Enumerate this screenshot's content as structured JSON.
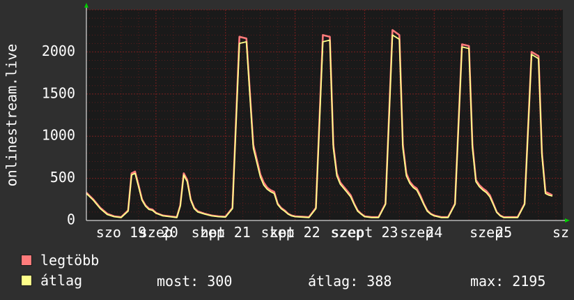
{
  "colors": {
    "background": "#2f2f2f",
    "plot_background": "#1a1a1a",
    "grid": "#7a1f1f",
    "axis": "#ffffff",
    "text": "#ffffff",
    "max_series": "#ff7b7b",
    "avg_series": "#ffff8a",
    "arrow": "#00cc00"
  },
  "legend": [
    {
      "label": "legtöbb",
      "color": "#ff7b7b"
    },
    {
      "label": "átlag",
      "color": "#ffff8a"
    }
  ],
  "stats": {
    "now": "most: 300",
    "avg": "átlag: 388",
    "max": "max: 2195"
  },
  "chart_data": {
    "type": "line",
    "title": "",
    "ylabel": "onlinestream.live",
    "xlabel": "",
    "ylim": [
      0,
      2500
    ],
    "y_ticks": [
      0,
      500,
      1000,
      1500,
      2000
    ],
    "grid": true,
    "legend_position": "bottom-left",
    "x_tick_labels": [
      {
        "label": "szo 19",
        "x": 0.5
      },
      {
        "label": "szep",
        "x": 1.0
      },
      {
        "label": "20",
        "x": 1.2
      },
      {
        "label": "szep",
        "x": 1.75
      },
      {
        "label": "hpt 21",
        "x": 2.0
      },
      {
        "label": "szep",
        "x": 2.75
      },
      {
        "label": "kpt 22",
        "x": 3.0
      },
      {
        "label": "szep",
        "x": 3.75
      },
      {
        "label": "szept 23",
        "x": 4.0
      },
      {
        "label": "szep",
        "x": 4.75
      },
      {
        "label": "24",
        "x": 5.0
      },
      {
        "label": "szep",
        "x": 5.75
      },
      {
        "label": "25",
        "x": 6.0
      },
      {
        "label": "sz",
        "x": 6.82
      }
    ],
    "x": [
      0.0,
      0.1,
      0.2,
      0.3,
      0.4,
      0.5,
      0.6,
      0.65,
      0.7,
      0.75,
      0.8,
      0.85,
      0.9,
      0.95,
      1.0,
      1.1,
      1.2,
      1.3,
      1.35,
      1.4,
      1.45,
      1.5,
      1.55,
      1.6,
      1.7,
      1.8,
      1.9,
      2.0,
      2.1,
      2.2,
      2.3,
      2.4,
      2.5,
      2.55,
      2.6,
      2.65,
      2.7,
      2.75,
      2.8,
      2.85,
      2.9,
      2.95,
      3.0,
      3.1,
      3.2,
      3.3,
      3.4,
      3.5,
      3.55,
      3.6,
      3.65,
      3.7,
      3.75,
      3.8,
      3.85,
      3.9,
      3.95,
      4.0,
      4.1,
      4.2,
      4.3,
      4.4,
      4.5,
      4.55,
      4.6,
      4.65,
      4.7,
      4.75,
      4.8,
      4.85,
      4.9,
      4.95,
      5.0,
      5.1,
      5.2,
      5.3,
      5.4,
      5.5,
      5.55,
      5.6,
      5.65,
      5.7,
      5.75,
      5.8,
      5.85,
      5.9,
      5.95,
      6.0,
      6.1,
      6.2,
      6.3,
      6.4,
      6.5,
      6.55,
      6.6,
      6.65,
      6.7,
      6.75,
      6.8,
      6.85
    ],
    "series": [
      {
        "name": "legtöbb",
        "color": "#ff7b7b",
        "values": [
          330,
          250,
          150,
          80,
          50,
          40,
          120,
          560,
          580,
          420,
          250,
          180,
          140,
          130,
          90,
          60,
          50,
          40,
          180,
          560,
          480,
          250,
          150,
          110,
          80,
          60,
          50,
          45,
          150,
          2180,
          2160,
          900,
          550,
          450,
          390,
          360,
          340,
          200,
          150,
          120,
          80,
          60,
          50,
          45,
          40,
          150,
          2200,
          2180,
          900,
          560,
          450,
          400,
          350,
          300,
          200,
          120,
          80,
          50,
          40,
          40,
          200,
          2260,
          2200,
          900,
          560,
          460,
          410,
          380,
          300,
          200,
          120,
          80,
          60,
          40,
          40,
          200,
          2090,
          2070,
          900,
          480,
          420,
          380,
          350,
          300,
          200,
          100,
          60,
          40,
          40,
          40,
          200,
          2000,
          1950,
          800,
          340,
          320,
          300
        ]
      },
      {
        "name": "átlag",
        "color": "#ffff8a",
        "values": [
          320,
          240,
          140,
          70,
          45,
          35,
          110,
          540,
          560,
          400,
          240,
          170,
          130,
          120,
          85,
          55,
          45,
          35,
          170,
          540,
          460,
          240,
          140,
          100,
          75,
          55,
          45,
          40,
          140,
          2100,
          2120,
          860,
          520,
          420,
          370,
          340,
          320,
          190,
          140,
          110,
          75,
          55,
          45,
          40,
          35,
          140,
          2120,
          2140,
          860,
          530,
          430,
          380,
          330,
          280,
          190,
          110,
          75,
          45,
          35,
          35,
          190,
          2200,
          2150,
          860,
          530,
          440,
          390,
          360,
          280,
          190,
          110,
          75,
          55,
          35,
          35,
          190,
          2060,
          2040,
          860,
          460,
          400,
          360,
          330,
          280,
          190,
          95,
          55,
          35,
          35,
          35,
          190,
          1970,
          1920,
          770,
          320,
          300,
          290
        ]
      }
    ]
  }
}
